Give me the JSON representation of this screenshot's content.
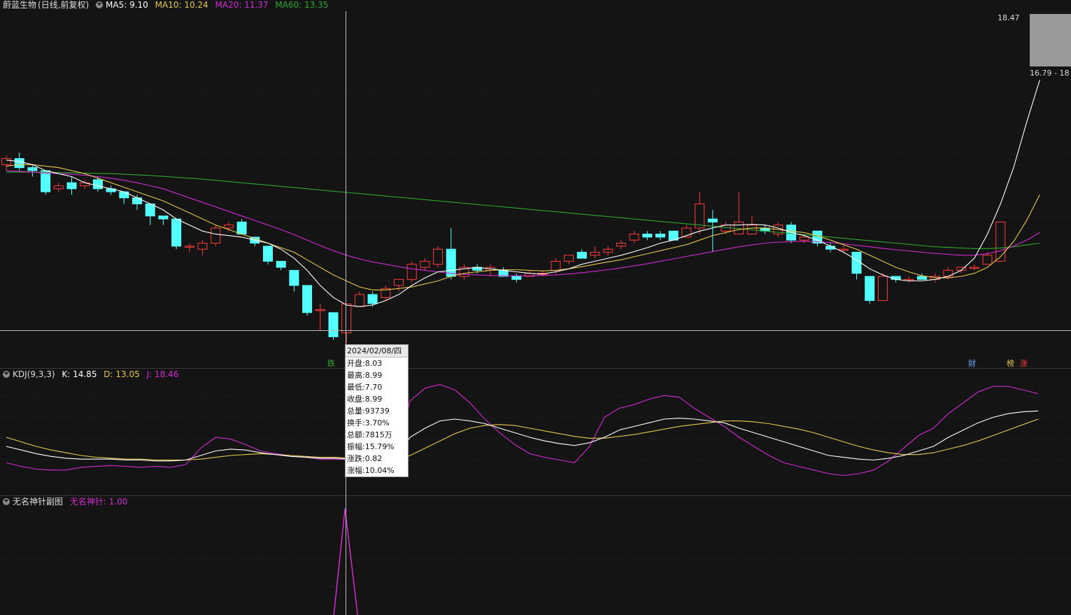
{
  "main_legend": {
    "stock_name": "蔚蓝生物",
    "period": "(日线,前复权)",
    "ma5": "MA5: 9.10",
    "ma10": "MA10: 10.24",
    "ma20": "MA20: 11.37",
    "ma60": "MA60: 13.35"
  },
  "kdj_legend": {
    "name": "KDJ(9,3,3)",
    "k": "K: 14.85",
    "d": "D: 13.05",
    "j": "J: 18.46"
  },
  "sub_legend": {
    "name": "无名神针副图",
    "value": "无名神针: 1.00"
  },
  "price_high": "18.47",
  "mini_range": "16.79 - 18",
  "markers": {
    "die": "跌",
    "cai": "财",
    "bang": "榜",
    "zhang": "涨"
  },
  "tooltip": {
    "date": "2024/02/08/四",
    "rows": [
      "开盘:8.03",
      "最高:8.99",
      "最低:7.70",
      "收盘:8.99",
      "总量:93739",
      "换手:3.70%",
      "总额:7815万",
      "振幅:15.79%",
      "涨跌:0.82",
      "涨幅:10.04%"
    ]
  },
  "colors": {
    "up": "#ff3b3b",
    "down": "#54ffff",
    "ma5": "#ffffff",
    "ma10": "#e6c84a",
    "ma20": "#d22bd2",
    "ma60": "#2ea82e",
    "kdj_j": "#d22bd2"
  },
  "chart_data": {
    "type": "candlestick",
    "candles": [
      [
        13.6,
        13.8,
        13.9,
        13.4
      ],
      [
        13.8,
        13.5,
        14.0,
        13.4
      ],
      [
        13.5,
        13.4,
        13.6,
        13.2
      ],
      [
        13.4,
        12.7,
        13.4,
        12.6
      ],
      [
        12.8,
        12.9,
        13.0,
        12.7
      ],
      [
        13.0,
        12.8,
        13.2,
        12.6
      ],
      [
        12.9,
        13.0,
        13.1,
        12.8
      ],
      [
        13.1,
        12.8,
        13.2,
        12.7
      ],
      [
        12.8,
        12.7,
        12.9,
        12.6
      ],
      [
        12.7,
        12.5,
        12.7,
        12.3
      ],
      [
        12.5,
        12.3,
        12.6,
        12.1
      ],
      [
        12.3,
        11.9,
        12.3,
        11.6
      ],
      [
        11.9,
        11.8,
        11.9,
        11.6
      ],
      [
        11.8,
        10.9,
        11.8,
        10.8
      ],
      [
        10.9,
        10.9,
        11.0,
        10.7
      ],
      [
        10.8,
        11.0,
        11.1,
        10.6
      ],
      [
        11.0,
        11.5,
        11.6,
        10.9
      ],
      [
        11.5,
        11.6,
        11.7,
        11.4
      ],
      [
        11.7,
        11.3,
        11.8,
        11.3
      ],
      [
        11.2,
        11.0,
        11.2,
        10.9
      ],
      [
        10.9,
        10.4,
        10.9,
        10.3
      ],
      [
        10.4,
        10.2,
        10.4,
        10.1
      ],
      [
        10.1,
        9.6,
        10.1,
        9.4
      ],
      [
        9.6,
        8.7,
        9.6,
        8.6
      ],
      [
        8.8,
        8.8,
        9.0,
        8.1
      ],
      [
        8.7,
        7.9,
        8.7,
        7.8
      ],
      [
        8.03,
        8.99,
        8.99,
        7.7
      ],
      [
        8.9,
        9.3,
        9.4,
        8.9
      ],
      [
        9.3,
        9.0,
        9.4,
        8.9
      ],
      [
        9.2,
        9.5,
        9.6,
        9.1
      ],
      [
        9.6,
        9.8,
        9.8,
        9.4
      ],
      [
        9.8,
        10.3,
        10.4,
        9.7
      ],
      [
        10.2,
        10.4,
        10.5,
        10.1
      ],
      [
        10.3,
        10.8,
        10.9,
        10.2
      ],
      [
        10.8,
        9.9,
        11.5,
        9.8
      ],
      [
        9.9,
        10.2,
        10.3,
        9.8
      ],
      [
        10.2,
        10.1,
        10.3,
        10.0
      ],
      [
        10.1,
        10.2,
        10.3,
        9.9
      ],
      [
        10.1,
        9.9,
        10.2,
        9.9
      ],
      [
        9.9,
        9.8,
        10.0,
        9.7
      ],
      [
        9.9,
        10.0,
        10.1,
        9.9
      ],
      [
        10.0,
        10.0,
        10.1,
        9.9
      ],
      [
        10.1,
        10.4,
        10.5,
        10.0
      ],
      [
        10.4,
        10.6,
        10.6,
        10.3
      ],
      [
        10.7,
        10.5,
        10.8,
        10.5
      ],
      [
        10.6,
        10.7,
        10.9,
        10.5
      ],
      [
        10.7,
        10.8,
        10.9,
        10.6
      ],
      [
        10.9,
        11.0,
        11.1,
        10.8
      ],
      [
        11.1,
        11.3,
        11.4,
        11.0
      ],
      [
        11.3,
        11.2,
        11.4,
        11.1
      ],
      [
        11.3,
        11.2,
        11.4,
        11.1
      ],
      [
        11.4,
        11.1,
        11.4,
        11.1
      ],
      [
        11.2,
        11.5,
        11.6,
        11.2
      ],
      [
        11.5,
        12.3,
        12.7,
        11.3
      ],
      [
        11.8,
        11.7,
        12.1,
        10.7
      ],
      [
        11.4,
        11.6,
        11.7,
        11.3
      ],
      [
        11.3,
        11.7,
        12.7,
        11.3
      ],
      [
        11.3,
        11.6,
        11.9,
        11.3
      ],
      [
        11.5,
        11.4,
        11.6,
        11.3
      ],
      [
        11.3,
        11.6,
        11.7,
        11.2
      ],
      [
        11.6,
        11.1,
        11.7,
        11.0
      ],
      [
        11.1,
        11.2,
        11.3,
        11.0
      ],
      [
        11.4,
        11.0,
        11.4,
        10.9
      ],
      [
        10.9,
        10.8,
        11.0,
        10.7
      ],
      [
        10.8,
        10.8,
        10.9,
        10.7
      ],
      [
        10.7,
        10.0,
        10.7,
        9.8
      ],
      [
        9.9,
        9.1,
        9.9,
        9.0
      ],
      [
        9.1,
        9.9,
        10.0,
        9.1
      ],
      [
        9.9,
        9.8,
        9.9,
        9.7
      ],
      [
        9.8,
        9.8,
        9.9,
        9.7
      ],
      [
        9.9,
        9.8,
        10.0,
        9.8
      ],
      [
        9.8,
        9.9,
        10.0,
        9.7
      ],
      [
        9.9,
        10.1,
        10.2,
        9.8
      ],
      [
        10.1,
        10.2,
        10.2,
        10.0
      ],
      [
        10.2,
        10.2,
        10.3,
        10.1
      ],
      [
        10.3,
        10.6,
        10.7,
        10.3
      ],
      [
        10.4,
        11.7,
        11.7,
        10.4
      ]
    ],
    "ma5": [
      13.75,
      13.7,
      13.6,
      13.4,
      13.3,
      13.2,
      13.0,
      12.9,
      12.8,
      12.7,
      12.5,
      12.3,
      12.1,
      11.8,
      11.6,
      11.4,
      11.3,
      11.25,
      11.2,
      11.1,
      11.0,
      10.8,
      10.5,
      10.1,
      9.6,
      9.2,
      8.95,
      8.9,
      8.95,
      9.1,
      9.3,
      9.6,
      9.85,
      10.05,
      10.1,
      10.15,
      10.2,
      10.15,
      10.1,
      10.05,
      10.0,
      9.98,
      10.05,
      10.15,
      10.3,
      10.4,
      10.5,
      10.6,
      10.72,
      10.85,
      11.0,
      11.1,
      11.25,
      11.4,
      11.5,
      11.6,
      11.6,
      11.62,
      11.6,
      11.5,
      11.35,
      11.25,
      11.1,
      10.9,
      10.7,
      10.45,
      10.15,
      9.95,
      9.8,
      9.75,
      9.75,
      9.8,
      9.9,
      10.1,
      10.5,
      11.3,
      12.3,
      13.5,
      15.0,
      16.4
    ],
    "ma10": [
      13.55,
      13.6,
      13.6,
      13.55,
      13.5,
      13.4,
      13.3,
      13.15,
      13.0,
      12.85,
      12.7,
      12.55,
      12.4,
      12.2,
      12.0,
      11.8,
      11.6,
      11.45,
      11.3,
      11.15,
      11.0,
      10.85,
      10.7,
      10.45,
      10.2,
      9.95,
      9.75,
      9.55,
      9.45,
      9.45,
      9.5,
      9.55,
      9.65,
      9.75,
      9.9,
      10.0,
      10.05,
      10.1,
      10.12,
      10.12,
      10.1,
      10.08,
      10.1,
      10.15,
      10.22,
      10.3,
      10.38,
      10.45,
      10.55,
      10.65,
      10.75,
      10.85,
      10.95,
      11.1,
      11.25,
      11.35,
      11.45,
      11.5,
      11.5,
      11.45,
      11.4,
      11.35,
      11.25,
      11.1,
      10.95,
      10.8,
      10.6,
      10.4,
      10.2,
      10.05,
      9.92,
      9.86,
      9.85,
      9.9,
      10.0,
      10.2,
      10.55,
      11.05,
      11.75,
      12.6
    ],
    "ma20": [
      13.4,
      13.38,
      13.35,
      13.32,
      13.3,
      13.28,
      13.25,
      13.2,
      13.15,
      13.08,
      13.0,
      12.9,
      12.8,
      12.65,
      12.5,
      12.35,
      12.2,
      12.05,
      11.9,
      11.75,
      11.6,
      11.45,
      11.28,
      11.1,
      10.92,
      10.75,
      10.6,
      10.48,
      10.38,
      10.3,
      10.22,
      10.15,
      10.1,
      10.05,
      10.0,
      9.97,
      9.95,
      9.93,
      9.92,
      9.92,
      9.92,
      9.93,
      9.95,
      9.98,
      10.02,
      10.07,
      10.12,
      10.18,
      10.25,
      10.32,
      10.4,
      10.48,
      10.56,
      10.64,
      10.72,
      10.8,
      10.88,
      10.94,
      11.0,
      11.03,
      11.05,
      11.06,
      11.05,
      11.02,
      10.98,
      10.93,
      10.88,
      10.83,
      10.78,
      10.74,
      10.7,
      10.66,
      10.63,
      10.6,
      10.6,
      10.65,
      10.75,
      10.9,
      11.1,
      11.35
    ],
    "ma60": [
      13.35,
      13.35,
      13.35,
      13.35,
      13.34,
      13.33,
      13.32,
      13.31,
      13.3,
      13.28,
      13.26,
      13.24,
      13.21,
      13.18,
      13.15,
      13.12,
      13.08,
      13.04,
      13.0,
      12.96,
      12.92,
      12.88,
      12.84,
      12.8,
      12.76,
      12.72,
      12.68,
      12.64,
      12.6,
      12.56,
      12.52,
      12.48,
      12.44,
      12.4,
      12.36,
      12.32,
      12.28,
      12.24,
      12.2,
      12.16,
      12.12,
      12.08,
      12.04,
      12.0,
      11.96,
      11.92,
      11.88,
      11.84,
      11.8,
      11.76,
      11.72,
      11.68,
      11.64,
      11.6,
      11.56,
      11.52,
      11.48,
      11.44,
      11.4,
      11.36,
      11.32,
      11.28,
      11.24,
      11.2,
      11.16,
      11.12,
      11.08,
      11.04,
      11.0,
      10.96,
      10.92,
      10.88,
      10.86,
      10.84,
      10.82,
      10.82,
      10.84,
      10.88,
      10.94,
      11.0
    ],
    "ymin": 7.7,
    "ymax": 18.47,
    "kdj": {
      "k": [
        30,
        26,
        22,
        19,
        17,
        16,
        16,
        16,
        15,
        15,
        14,
        14,
        15,
        20,
        25,
        27,
        26,
        23,
        21,
        19,
        18,
        17,
        17,
        16,
        15,
        14,
        14.85,
        40,
        50,
        58,
        60,
        58,
        55,
        50,
        45,
        40,
        36,
        33,
        31,
        34,
        40,
        48,
        52,
        56,
        60,
        61,
        60,
        58,
        56,
        50,
        45,
        40,
        35,
        30,
        25,
        20,
        18,
        16,
        15,
        17,
        20,
        25,
        30,
        40,
        48,
        56,
        62,
        66,
        68,
        69
      ],
      "d": [
        40,
        35,
        30,
        26,
        23,
        20,
        18,
        17,
        16,
        16,
        15,
        15,
        15,
        16,
        18,
        20,
        21,
        22,
        21,
        20,
        19,
        18,
        18,
        17,
        16,
        15,
        13.05,
        20,
        28,
        36,
        44,
        50,
        53,
        54,
        53,
        50,
        47,
        44,
        41,
        39,
        39,
        41,
        43,
        46,
        49,
        52,
        54,
        56,
        58,
        58,
        57,
        55,
        52,
        49,
        45,
        40,
        35,
        30,
        26,
        23,
        21,
        21,
        23,
        27,
        31,
        36,
        42,
        48,
        54,
        60
      ],
      "j": [
        12,
        8,
        5,
        4,
        4,
        7,
        8,
        9,
        8,
        7,
        8,
        7,
        10,
        28,
        40,
        38,
        32,
        25,
        22,
        20,
        18,
        16,
        16,
        15,
        12,
        8,
        18.46,
        80,
        94,
        98,
        92,
        78,
        60,
        45,
        32,
        22,
        18,
        15,
        12,
        30,
        62,
        72,
        76,
        82,
        86,
        84,
        72,
        62,
        52,
        40,
        30,
        20,
        12,
        8,
        4,
        0,
        -2,
        0,
        4,
        14,
        28,
        42,
        50,
        66,
        78,
        90,
        96,
        96,
        92,
        88
      ]
    },
    "spike": {
      "x": 26,
      "value": 1.0
    }
  }
}
